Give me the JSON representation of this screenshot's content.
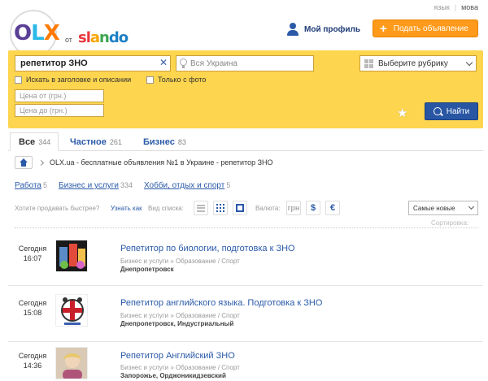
{
  "topbar": {
    "lang_label": "язык",
    "lang_active": "мова"
  },
  "logo": {
    "o": "O",
    "l": "L",
    "x": "X",
    "ot": "от",
    "slando_1": "sl",
    "slando_2": "a",
    "slando_3": "n",
    "slando_4": "do"
  },
  "header": {
    "profile_label": "Мой профиль",
    "post_label": "Подать объявление"
  },
  "search": {
    "query": "репетитор ЗНО",
    "location_placeholder": "Вся Украина",
    "category_label": "Выберите рубрику",
    "check_title": "Искать в заголовке и описании",
    "check_photo": "Только с фото",
    "price_from": "Цена от (грн.)",
    "price_to": "Цена до (грн.)",
    "find_label": "Найти"
  },
  "tabs": [
    {
      "label": "Все",
      "count": "344"
    },
    {
      "label": "Частное",
      "count": "261"
    },
    {
      "label": "Бизнес",
      "count": "83"
    }
  ],
  "breadcrumb": {
    "text": "OLX.ua - бесплатные объявления №1 в Украине - репетитор ЗНО"
  },
  "categories": [
    {
      "label": "Работа",
      "count": "5"
    },
    {
      "label": "Бизнес и услуги",
      "count": "334"
    },
    {
      "label": "Хобби, отдых и спорт",
      "count": "5"
    }
  ],
  "toolbar": {
    "sell_question": "Хотите продавать быстрее?",
    "sell_link": "Узнать как",
    "view_label": "Вид списка:",
    "currency_label": "Валюта:",
    "uah": "грн",
    "usd": "$",
    "eur": "€",
    "sort_value": "Самые новые",
    "sort_label": "Сортировка:"
  },
  "listings": [
    {
      "date_day": "Сегодня",
      "date_time": "16:07",
      "title": "Репетитор по биологии, подготовка к ЗНО",
      "category": "Бизнес и услуги » Образование / Спорт",
      "location": "Днепропетровск"
    },
    {
      "date_day": "Сегодня",
      "date_time": "15:08",
      "title": "Репетитор английского языка. Подготовка к ЗНО",
      "category": "Бизнес и услуги » Образование / Спорт",
      "location": "Днепропетровск, Индустриальный"
    },
    {
      "date_day": "Сегодня",
      "date_time": "14:36",
      "title": "Репетитор Английский ЗНО",
      "category": "Бизнес и услуги » Образование / Спорт",
      "location": "Запорожье, Орджоникидзевский"
    }
  ]
}
